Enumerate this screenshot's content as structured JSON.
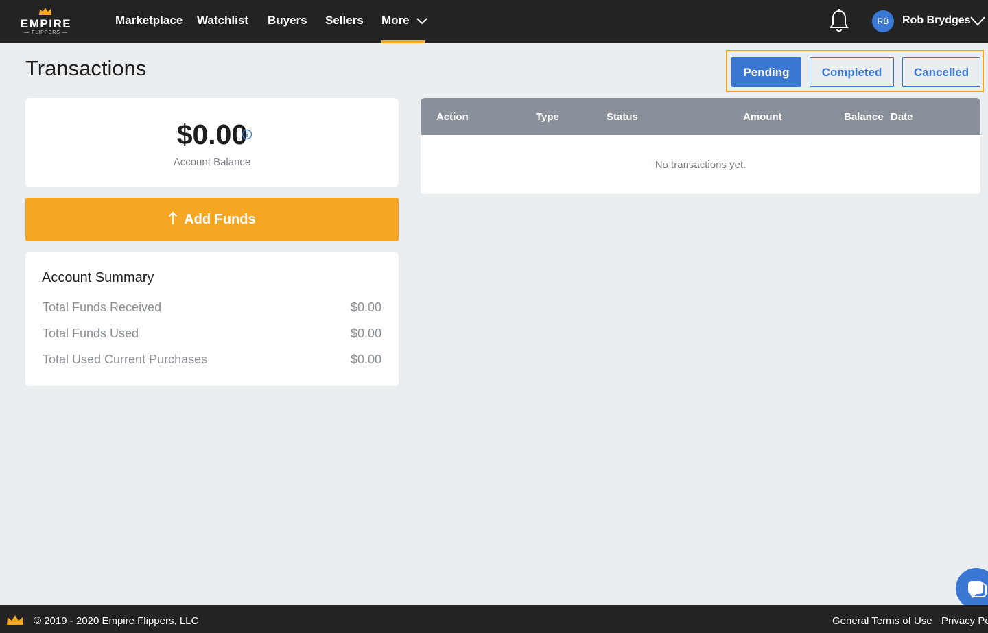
{
  "brand": {
    "logo_word": "EMPIRE",
    "logo_sub": "— FLIPPERS —",
    "accent_color": "#f5a623",
    "primary_color": "#3b78d4"
  },
  "nav": {
    "items": [
      {
        "label": "Marketplace"
      },
      {
        "label": "Watchlist"
      },
      {
        "label": "Buyers"
      },
      {
        "label": "Sellers"
      },
      {
        "label": "More"
      }
    ],
    "notifications_icon": "bell-icon",
    "user": {
      "initials": "RB",
      "name": "Rob Brydges"
    }
  },
  "page": {
    "title": "Transactions"
  },
  "tabs": [
    {
      "label": "Pending",
      "active": true
    },
    {
      "label": "Completed",
      "active": false
    },
    {
      "label": "Cancelled",
      "active": false
    }
  ],
  "balance": {
    "amount": "$0.00",
    "label": "Account Balance",
    "info_icon": "info-icon"
  },
  "add_funds": {
    "label": "Add Funds",
    "icon": "arrow-up-icon"
  },
  "summary": {
    "title": "Account Summary",
    "rows": [
      {
        "label": "Total Funds Received",
        "value": "$0.00"
      },
      {
        "label": "Total Funds Used",
        "value": "$0.00"
      },
      {
        "label": "Total Used Current Purchases",
        "value": "$0.00"
      }
    ]
  },
  "transactions": {
    "columns": [
      "Action",
      "Type",
      "Status",
      "Amount",
      "Balance",
      "Date"
    ],
    "empty_message": "No transactions yet."
  },
  "footer": {
    "copyright": "© 2019 - 2020 Empire Flippers, LLC",
    "links": [
      "General Terms of Use",
      "Privacy Pol"
    ]
  }
}
